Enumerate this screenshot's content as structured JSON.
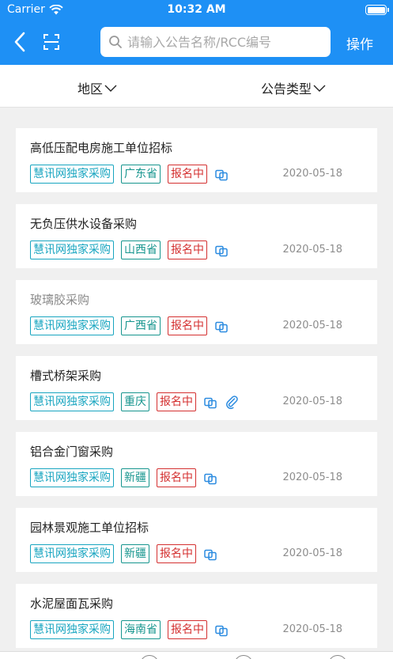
{
  "status_bar": {
    "carrier": "Carrier",
    "time": "10:32 AM"
  },
  "nav": {
    "search_placeholder": "请输入公告名称/RCC编号",
    "action_label": "操作"
  },
  "filters": {
    "region_label": "地区",
    "type_label": "公告类型"
  },
  "announcements": [
    {
      "title": "高低压配电房施工单位招标",
      "source": "慧讯网独家采购",
      "region": "广东省",
      "status": "报名中",
      "date": "2020-05-18",
      "read": false,
      "attachment": false
    },
    {
      "title": "无负压供水设备采购",
      "source": "慧讯网独家采购",
      "region": "山西省",
      "status": "报名中",
      "date": "2020-05-18",
      "read": false,
      "attachment": false
    },
    {
      "title": "玻璃胶采购",
      "source": "慧讯网独家采购",
      "region": "广西省",
      "status": "报名中",
      "date": "2020-05-18",
      "read": true,
      "attachment": false
    },
    {
      "title": "槽式桥架采购",
      "source": "慧讯网独家采购",
      "region": "重庆",
      "status": "报名中",
      "date": "2020-05-18",
      "read": false,
      "attachment": true
    },
    {
      "title": "铝合金门窗采购",
      "source": "慧讯网独家采购",
      "region": "新疆",
      "status": "报名中",
      "date": "2020-05-18",
      "read": false,
      "attachment": false
    },
    {
      "title": "园林景观施工单位招标",
      "source": "慧讯网独家采购",
      "region": "新疆",
      "status": "报名中",
      "date": "2020-05-18",
      "read": false,
      "attachment": false
    },
    {
      "title": "水泥屋面瓦采购",
      "source": "慧讯网独家采购",
      "region": "海南省",
      "status": "报名中",
      "date": "2020-05-18",
      "read": false,
      "attachment": false
    }
  ],
  "colors": {
    "primary": "#1e90f5",
    "tag_source": "#18a5c0",
    "tag_region": "#16958e",
    "tag_status": "#d43030"
  }
}
